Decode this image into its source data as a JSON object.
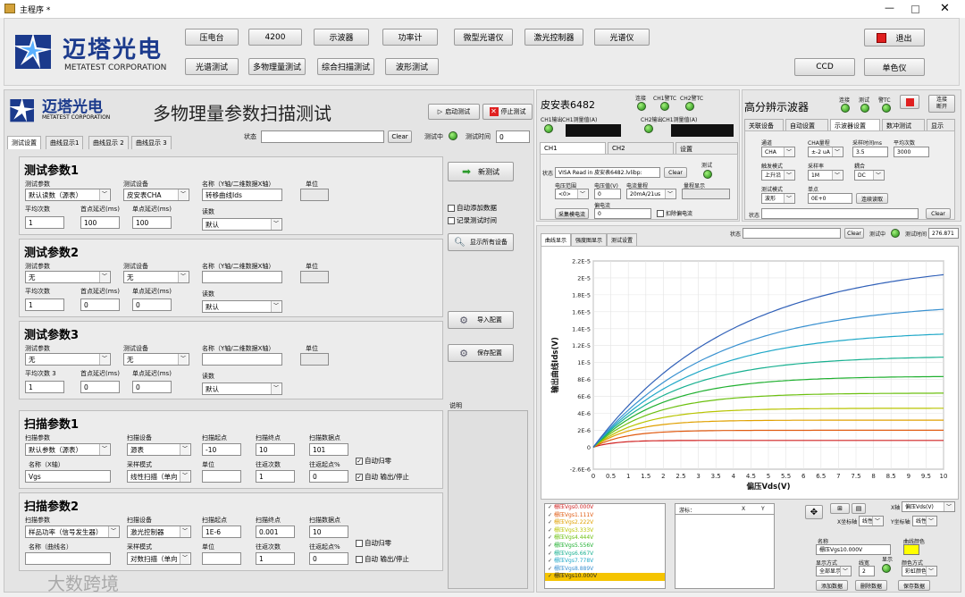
{
  "window": {
    "title": "主程序 *"
  },
  "logo": {
    "cn": "迈塔光电",
    "en": "METATEST CORPORATION"
  },
  "toolbar": {
    "row1": [
      "压电台",
      "4200",
      "示波器",
      "功率计",
      "微型光谱仪",
      "激光控制器",
      "光谱仪"
    ],
    "row2": [
      "光谱测试",
      "多物理量测试",
      "综合扫描测试",
      "波形测试"
    ],
    "exit": "退出",
    "ccd": "CCD",
    "mono": "单色仪"
  },
  "panel": {
    "title": "多物理量参数扫描测试",
    "start": "启动测试",
    "stop": "停止测试",
    "tabs": [
      "测试设置",
      "曲线显示1",
      "曲线显示 2",
      "曲线显示 3"
    ],
    "status_label": "状态",
    "clear": "Clear",
    "testing": "测试中",
    "test_time": "测试时间",
    "test_time_val": "0"
  },
  "test1": {
    "title": "测试参数1",
    "param_label": "测试参数",
    "param": "默认读数（源表）",
    "dev_label": "测试设备",
    "dev": "皮安表CHA",
    "name_label": "名称（Y轴/二维数据X轴）",
    "name": "转移曲线Ids",
    "unit_label": "单位",
    "avg_label": "平均次数",
    "avg": "1",
    "first_label": "首点延迟(ms)",
    "first": "100",
    "delay_label": "单点延迟(ms)",
    "delay": "100",
    "read_label": "读数",
    "read": "默认"
  },
  "test2": {
    "title": "测试参数2",
    "param_label": "测试参数",
    "param": "无",
    "dev_label": "测试设备",
    "dev": "无",
    "name_label": "名称（Y轴/二维数据X轴）",
    "unit_label": "单位",
    "avg_label": "平均次数",
    "avg": "1",
    "first_label": "首点延迟(ms)",
    "first": "0",
    "delay_label": "单点延迟(ms)",
    "delay": "0",
    "read_label": "读数",
    "read": "默认"
  },
  "test3": {
    "title": "测试参数3",
    "param_label": "测试参数",
    "param": "无",
    "dev_label": "测试设备",
    "dev": "无",
    "name_label": "名称（Y轴/二维数据X轴）",
    "unit_label": "单位",
    "avg_label": "平均次数 3",
    "avg": "1",
    "first_label": "首点延迟(ms)",
    "first": "0",
    "delay_label": "单点延迟(ms)",
    "delay": "0",
    "read_label": "读数",
    "read": "默认"
  },
  "scan1": {
    "title": "扫描参数1",
    "param_label": "扫描参数",
    "param": "默认参数（源表）",
    "dev_label": "扫描设备",
    "dev": "源表",
    "start_label": "扫描起点",
    "start": "-10",
    "end_label": "扫描终点",
    "end": "10",
    "pts_label": "扫描数据点",
    "pts": "101",
    "name_label": "名称（X轴）",
    "name": "Vgs",
    "mode_label": "采样模式",
    "mode": "线性扫描（单向",
    "unit_label": "单位",
    "ret_label": "往返次数",
    "ret": "1",
    "retpt_label": "往返起点%",
    "retpt": "0",
    "auto_reset": "自动归零",
    "auto_out": "自动 输出/停止"
  },
  "scan2": {
    "title": "扫描参数2",
    "param_label": "扫描参数",
    "param": "样品功率（信号发生器）",
    "dev_label": "扫描设备",
    "dev": "激光控制器",
    "start_label": "扫描起点",
    "start": "1E-6",
    "end_label": "扫描终点",
    "end": "0.001",
    "pts_label": "扫描数据点",
    "pts": "10",
    "name_label": "名称（曲线名）",
    "mode_label": "采样模式",
    "mode": "对数扫描（单向",
    "unit_label": "单位",
    "ret_label": "往返次数",
    "ret": "1",
    "retpt_label": "往返起点%",
    "retpt": "0",
    "auto_reset": "自动归零",
    "auto_out": "自动 输出/停止"
  },
  "side": {
    "new_test": "新测试",
    "auto_add": "自动添加数据",
    "record_time": "记录测试时间",
    "show_dev": "显示所有设备",
    "import": "导入配置",
    "save": "保存配置",
    "note_label": "说明"
  },
  "pico": {
    "title": "皮安表6482",
    "connect": "连接",
    "ch1": "CH1警TC",
    "ch2": "CH2警TC",
    "ch1_out": "CH1输出",
    "ch1_meas": "CH1测量值(A)",
    "ch2_out": "CH2输出",
    "ch2_meas": "CH1测量值(A)",
    "tabs": [
      "CH1",
      "CH2",
      "设置"
    ],
    "status_label": "状态",
    "status": "VISA Read in 皮安表6482.lvlibp:",
    "clear": "Clear",
    "test_label": "测试",
    "vrange_label": "电压范围",
    "vrange": "<0>",
    "volt_label": "电压值(V)",
    "volt": "0",
    "irange_label": "电流量程",
    "irange": "20mA/21us",
    "range_disp_label": "量程显示",
    "meas_cur": "采集模电流",
    "bias_label": "偏电流",
    "bias": "0",
    "ext": "扣除偏电流"
  },
  "scope": {
    "title": "高分辨示波器",
    "connect": "连接",
    "test": "测试",
    "alarm": "警TC",
    "tabs": [
      "关联设备",
      "自动设置",
      "示波器设置",
      "数冲测试",
      "显示"
    ],
    "ch_label": "通道",
    "ch": "CHA",
    "range_label": "CHA量程",
    "range": "±-2 uA",
    "stime_label": "采样时间ms",
    "stime": "3.5",
    "avg_label": "平均次数",
    "avg": "3000",
    "trig_label": "触发模式",
    "trig": "上升沿",
    "rate_label": "采样率",
    "rate": "1M",
    "coup_label": "耦合",
    "coup": "DC",
    "mode_label": "测试模式",
    "mode": "波形",
    "pt_label": "单点",
    "pt": "0E+0",
    "cont": "连续读取",
    "status_label": "状态",
    "clear": "Clear",
    "disconnect": "连接\n断开"
  },
  "plotpanel": {
    "tabs": [
      "曲线显示",
      "强度图显示",
      "测试设置"
    ],
    "status_label": "状态",
    "clear": "Clear",
    "testing": "测试中",
    "test_time": "测试时间",
    "test_time_val": "276.871"
  },
  "legend": {
    "items": [
      "栅压Vgs0.000V",
      "栅压Vgs1.111V",
      "栅压Vgs2.222V",
      "栅压Vgs3.333V",
      "栅压Vgs4.444V",
      "栅压Vgs5.556V",
      "栅压Vgs6.667V",
      "栅压Vgs7.778V",
      "栅压Vgs8.889V",
      "栅压Vgs10.000V"
    ]
  },
  "cursor": {
    "cols": [
      "游标：",
      "X",
      "Y"
    ]
  },
  "controls": {
    "x_label": "X轴",
    "x_val": "偏压Vds(V)",
    "xscale": "X坐标轴",
    "xscale_val": "线性",
    "yscale": "Y坐标轴",
    "yscale_val": "线性",
    "name_label": "名称",
    "name": "栅压Vgs10.000V",
    "color_label": "曲线颜色",
    "disp_label": "显示方式",
    "disp": "全部显示",
    "width_label": "线宽",
    "width": "2",
    "show_label": "显示",
    "colormode_label": "颜色方式",
    "colormode": "彩虹颜色",
    "add": "添加数据",
    "del": "删除数据",
    "save": "保存数据"
  },
  "watermark": "大数跨境",
  "colors": {
    "accent": "#1b3a8c",
    "led": "#2aa31a",
    "exit_red": "#e02020"
  },
  "chart_data": {
    "type": "line",
    "xlabel": "偏压Vds(V)",
    "ylabel": "输出曲线Ids(V)",
    "xlim": [
      0,
      10
    ],
    "ylim": [
      -2.6e-06,
      2.2e-05
    ],
    "x_ticks": [
      "0",
      "0.5",
      "1",
      "1.5",
      "2",
      "2.5",
      "3",
      "3.5",
      "4",
      "4.5",
      "5",
      "5.5",
      "6",
      "6.5",
      "7",
      "7.5",
      "8",
      "8.5",
      "9",
      "9.5",
      "10"
    ],
    "y_ticks": [
      "-2.6E-6",
      "0",
      "2E-6",
      "4E-6",
      "6E-6",
      "8E-6",
      "1E-5",
      "1.2E-5",
      "1.4E-5",
      "1.6E-5",
      "1.8E-5",
      "2E-5",
      "2.2E-5"
    ],
    "y_tick_values": [
      -2.6e-06,
      0,
      2e-06,
      4e-06,
      6e-06,
      8e-06,
      1e-05,
      1.2e-05,
      1.4e-05,
      1.6e-05,
      1.8e-05,
      2e-05,
      2.2e-05
    ],
    "series": [
      {
        "name": "栅压Vgs0.000V",
        "color": "#d02020",
        "sat": 8e-07,
        "tau": 0.6
      },
      {
        "name": "栅压Vgs1.111V",
        "color": "#e05a10",
        "sat": 2e-06,
        "tau": 0.9
      },
      {
        "name": "栅压Vgs2.222V",
        "color": "#e0a000",
        "sat": 3.2e-06,
        "tau": 1.1
      },
      {
        "name": "栅压Vgs3.333V",
        "color": "#b8c400",
        "sat": 4.6e-06,
        "tau": 1.4
      },
      {
        "name": "栅压Vgs4.444V",
        "color": "#6cc010",
        "sat": 6.4e-06,
        "tau": 1.7
      },
      {
        "name": "栅压Vgs5.556V",
        "color": "#20b030",
        "sat": 8.4e-06,
        "tau": 2.0
      },
      {
        "name": "栅压Vgs6.667V",
        "color": "#18b090",
        "sat": 1.08e-05,
        "tau": 2.4
      },
      {
        "name": "栅压Vgs7.778V",
        "color": "#20a8c8",
        "sat": 1.38e-05,
        "tau": 2.9
      },
      {
        "name": "栅压Vgs8.889V",
        "color": "#3890d0",
        "sat": 1.72e-05,
        "tau": 3.4
      },
      {
        "name": "栅压Vgs10.000V",
        "color": "#3060b8",
        "sat": 2.22e-05,
        "tau": 4.0
      }
    ]
  }
}
